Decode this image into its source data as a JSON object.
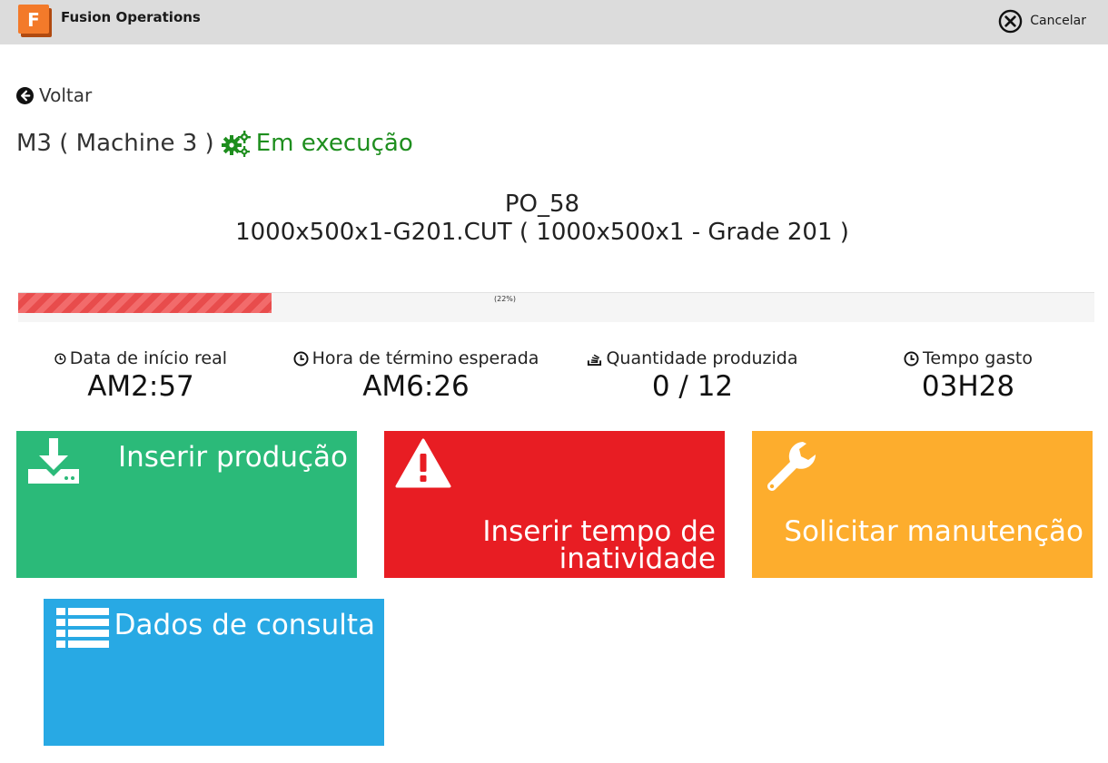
{
  "header": {
    "app_title": "Fusion Operations",
    "logo_letter": "F",
    "cancel_label": "Cancelar"
  },
  "nav": {
    "back_label": "Voltar"
  },
  "machine": {
    "name": "M3 ( Machine 3 )",
    "status": "Em execução"
  },
  "order": {
    "po": "PO_58",
    "part": "1000x500x1-G201.CUT ( 1000x500x1 - Grade 201 )"
  },
  "progress": {
    "percent": 22,
    "label": "(22%)"
  },
  "stats": [
    {
      "label": "Data de início real",
      "value": "AM2:57",
      "icon": "clock-icon"
    },
    {
      "label": "Hora de término esperada",
      "value": "AM6:26",
      "icon": "clock-icon"
    },
    {
      "label": "Quantidade produzida",
      "value": "0 / 12",
      "icon": "stack-icon"
    },
    {
      "label": "Tempo gasto",
      "value": "03H28",
      "icon": "clock-icon"
    }
  ],
  "tiles": {
    "insert_production": "Inserir produção",
    "downtime_line1": "Inserir tempo de",
    "downtime_line2": "inatividade",
    "maintenance": "Solicitar manutenção",
    "lookup": "Dados de consulta"
  },
  "colors": {
    "green_tile": "#2bba79",
    "red_tile": "#e81d23",
    "orange_tile": "#fdad2d",
    "blue_tile": "#28a9e4",
    "status_green": "#1e8e1e",
    "progress_red": "#e84c4c"
  }
}
